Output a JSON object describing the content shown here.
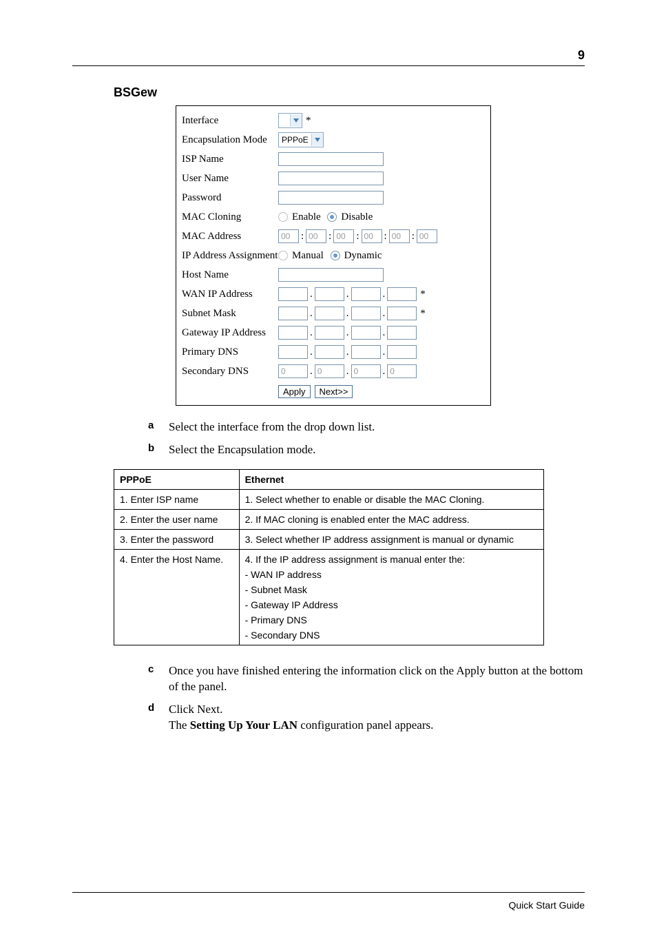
{
  "page_number": "9",
  "section_heading": "BSGew",
  "panel": {
    "labels": {
      "interface": "Interface",
      "encap": "Encapsulation Mode",
      "isp": "ISP Name",
      "user": "User Name",
      "pass": "Password",
      "macclone": "MAC Cloning",
      "macaddr": "MAC Address",
      "ipassign": "IP Address Assignment",
      "hostname": "Host Name",
      "wanip": "WAN IP Address",
      "subnet": "Subnet Mask",
      "gwip": "Gateway IP Address",
      "pdns": "Primary DNS",
      "sdns": "Secondary DNS"
    },
    "interface_value": "",
    "encap_value": "PPPoE",
    "star": "*",
    "macclone_opts": {
      "enable": "Enable",
      "disable": "Disable"
    },
    "mac_octets": [
      "00",
      "00",
      "00",
      "00",
      "00",
      "00"
    ],
    "colon": ":",
    "ipassign_opts": {
      "manual": "Manual",
      "dynamic": "Dynamic"
    },
    "dot": ".",
    "secdns_octets": [
      "0",
      "0",
      "0",
      "0"
    ],
    "buttons": {
      "apply": "Apply",
      "next": "Next>>"
    }
  },
  "instructions": {
    "a": "Select the interface from the drop down list.",
    "b": "Select the Encapsulation mode.",
    "c": "Once you have finished entering the information click on the Apply button at the bottom of the panel.",
    "d_line1": "Click Next.",
    "d_line2a": "The ",
    "d_line2b": "Setting Up Your LAN",
    "d_line2c": " configuration panel appears."
  },
  "table": {
    "head": {
      "col1": "PPPoE",
      "col2": "Ethernet"
    },
    "rows": [
      {
        "c1": "1. Enter ISP name",
        "c2": "1. Select whether to enable or disable the MAC Cloning."
      },
      {
        "c1": "2. Enter the user name",
        "c2": "2. If MAC cloning is enabled enter the MAC address."
      },
      {
        "c1": "3. Enter the password",
        "c2": "3. Select whether IP address assignment is manual or dynamic"
      },
      {
        "c1": "4. Enter the Host Name.",
        "c2_main": "4. If the IP address assignment is manual enter the:",
        "c2_sub": [
          "- WAN IP address",
          "- Subnet Mask",
          "- Gateway IP Address",
          "- Primary DNS",
          "- Secondary DNS"
        ]
      }
    ]
  },
  "footer": "Quick Start Guide"
}
